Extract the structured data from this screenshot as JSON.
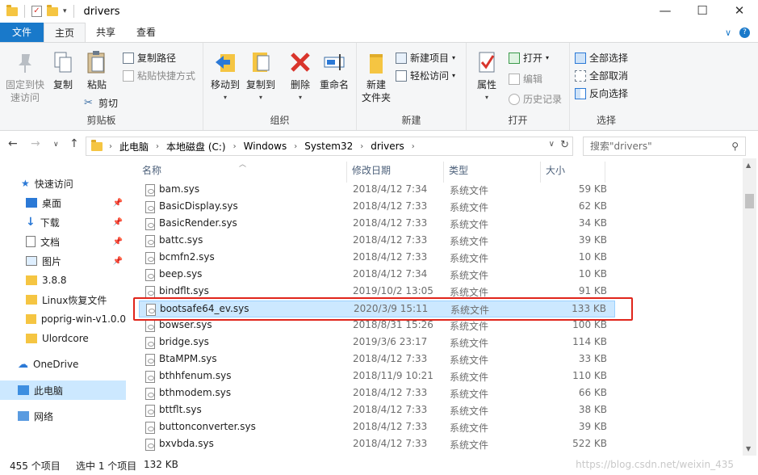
{
  "window": {
    "title": "drivers",
    "minimize": "—",
    "maximize": "☐",
    "close": "✕"
  },
  "ribbon_tabs": {
    "file": "文件",
    "home": "主页",
    "share": "共享",
    "view": "查看",
    "chevron": "∨",
    "help": "?"
  },
  "ribbon": {
    "clipboard": {
      "label": "剪贴板",
      "pin_quick": "固定到快速访问",
      "pin_quick_l1": "固定到快",
      "pin_quick_l2": "速访问",
      "copy": "复制",
      "paste": "粘贴",
      "copy_path": "复制路径",
      "paste_shortcut": "粘贴快捷方式",
      "cut": "剪切"
    },
    "organize": {
      "label": "组织",
      "move_to": "移动到",
      "copy_to": "复制到",
      "delete": "删除",
      "rename": "重命名"
    },
    "new": {
      "label": "新建",
      "new_folder_l1": "新建",
      "new_folder_l2": "文件夹",
      "new_item": "新建项目",
      "easy_access": "轻松访问"
    },
    "open": {
      "label": "打开",
      "properties": "属性",
      "open": "打开",
      "edit": "编辑",
      "history": "历史记录"
    },
    "select": {
      "label": "选择",
      "select_all": "全部选择",
      "select_none": "全部取消",
      "invert": "反向选择"
    }
  },
  "address": {
    "crumbs": [
      "此电脑",
      "本地磁盘 (C:)",
      "Windows",
      "System32",
      "drivers"
    ],
    "search_placeholder": "搜索\"drivers\""
  },
  "nav": {
    "quick_access": "快速访问",
    "desktop": "桌面",
    "downloads": "下载",
    "documents": "文档",
    "pictures": "图片",
    "f1": "3.8.8",
    "f2": "Linux恢复文件",
    "f3": "poprig-win-v1.0.0",
    "f4": "Ulordcore",
    "onedrive": "OneDrive",
    "this_pc": "此电脑",
    "network": "网络"
  },
  "columns": {
    "name": "名称",
    "date": "修改日期",
    "type": "类型",
    "size": "大小"
  },
  "files": [
    {
      "name": "bam.sys",
      "date": "2018/4/12 7:34",
      "type": "系统文件",
      "size": "59 KB"
    },
    {
      "name": "BasicDisplay.sys",
      "date": "2018/4/12 7:33",
      "type": "系统文件",
      "size": "62 KB"
    },
    {
      "name": "BasicRender.sys",
      "date": "2018/4/12 7:33",
      "type": "系统文件",
      "size": "34 KB"
    },
    {
      "name": "battc.sys",
      "date": "2018/4/12 7:33",
      "type": "系统文件",
      "size": "39 KB"
    },
    {
      "name": "bcmfn2.sys",
      "date": "2018/4/12 7:33",
      "type": "系统文件",
      "size": "10 KB"
    },
    {
      "name": "beep.sys",
      "date": "2018/4/12 7:34",
      "type": "系统文件",
      "size": "10 KB"
    },
    {
      "name": "bindflt.sys",
      "date": "2019/10/2 13:05",
      "type": "系统文件",
      "size": "91 KB"
    },
    {
      "name": "bootsafe64_ev.sys",
      "date": "2020/3/9 15:11",
      "type": "系统文件",
      "size": "133 KB"
    },
    {
      "name": "bowser.sys",
      "date": "2018/8/31 15:26",
      "type": "系统文件",
      "size": "100 KB"
    },
    {
      "name": "bridge.sys",
      "date": "2019/3/6 23:17",
      "type": "系统文件",
      "size": "114 KB"
    },
    {
      "name": "BtaMPM.sys",
      "date": "2018/4/12 7:33",
      "type": "系统文件",
      "size": "33 KB"
    },
    {
      "name": "bthhfenum.sys",
      "date": "2018/11/9 10:21",
      "type": "系统文件",
      "size": "110 KB"
    },
    {
      "name": "bthmodem.sys",
      "date": "2018/4/12 7:33",
      "type": "系统文件",
      "size": "66 KB"
    },
    {
      "name": "bttflt.sys",
      "date": "2018/4/12 7:33",
      "type": "系统文件",
      "size": "38 KB"
    },
    {
      "name": "buttonconverter.sys",
      "date": "2018/4/12 7:33",
      "type": "系统文件",
      "size": "39 KB"
    },
    {
      "name": "bxvbda.sys",
      "date": "2018/4/12 7:33",
      "type": "系统文件",
      "size": "522 KB"
    }
  ],
  "selected_index": 7,
  "status": {
    "count": "455 个项目",
    "selected": "选中 1 个项目",
    "size": "132 KB"
  },
  "watermark": "https://blog.csdn.net/weixin_435",
  "colors": {
    "accent": "#1979ca",
    "selection": "#cce8ff",
    "highlight": "#e0251b"
  }
}
